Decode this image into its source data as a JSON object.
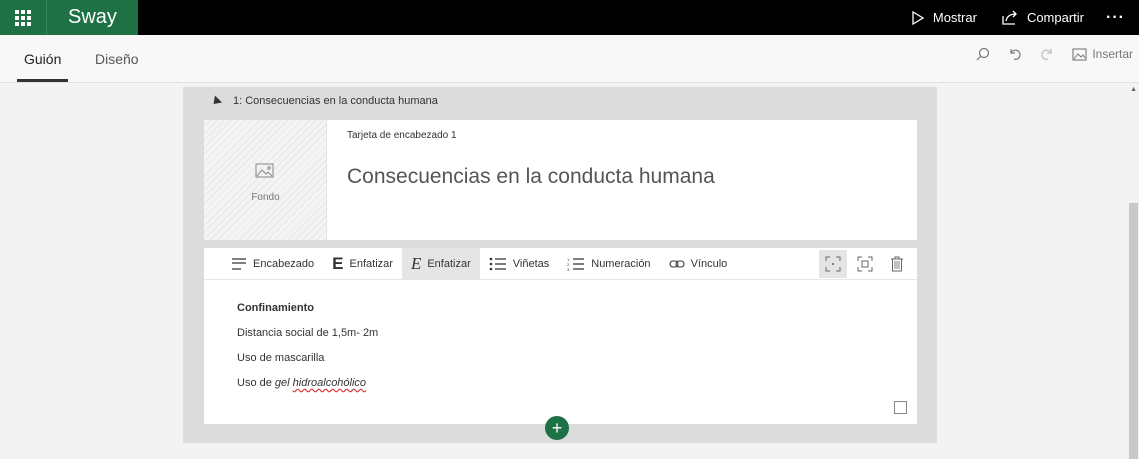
{
  "app": {
    "name": "Sway"
  },
  "topbar": {
    "present_label": "Mostrar",
    "share_label": "Compartir",
    "more_label": "···"
  },
  "tabs": [
    {
      "label": "Guión",
      "active": true
    },
    {
      "label": "Diseño",
      "active": false
    }
  ],
  "toolbar": {
    "insert_label": "Insertar"
  },
  "section": {
    "title": "1: Consecuencias en la conducta humana"
  },
  "heading_card": {
    "kind": "Tarjeta de encabezado 1",
    "background_label": "Fondo",
    "heading": "Consecuencias en la conducta humana"
  },
  "format_bar": {
    "items": [
      {
        "label": "Encabezado",
        "icon": "heading-icon"
      },
      {
        "label": "Enfatizar",
        "icon": "bold-icon"
      },
      {
        "label": "Enfatizar",
        "icon": "italic-icon",
        "selected": true
      },
      {
        "label": "Viñetas",
        "icon": "bullets-icon"
      },
      {
        "label": "Numeración",
        "icon": "numbering-icon"
      },
      {
        "label": "Vínculo",
        "icon": "link-icon"
      }
    ]
  },
  "text_card": {
    "line1": "Confinamiento",
    "line2": "Distancia social de 1,5m- 2m",
    "line3": "Uso de mascarilla",
    "line4_prefix": "Uso de ",
    "line4_italic": "gel",
    "line4_space": " ",
    "line4_misspelled": "hidroalcohólico"
  },
  "add_button": {
    "label": "+"
  },
  "colors": {
    "accent": "#1e7145",
    "topbar": "#000000",
    "panel": "#dcdcdc"
  }
}
